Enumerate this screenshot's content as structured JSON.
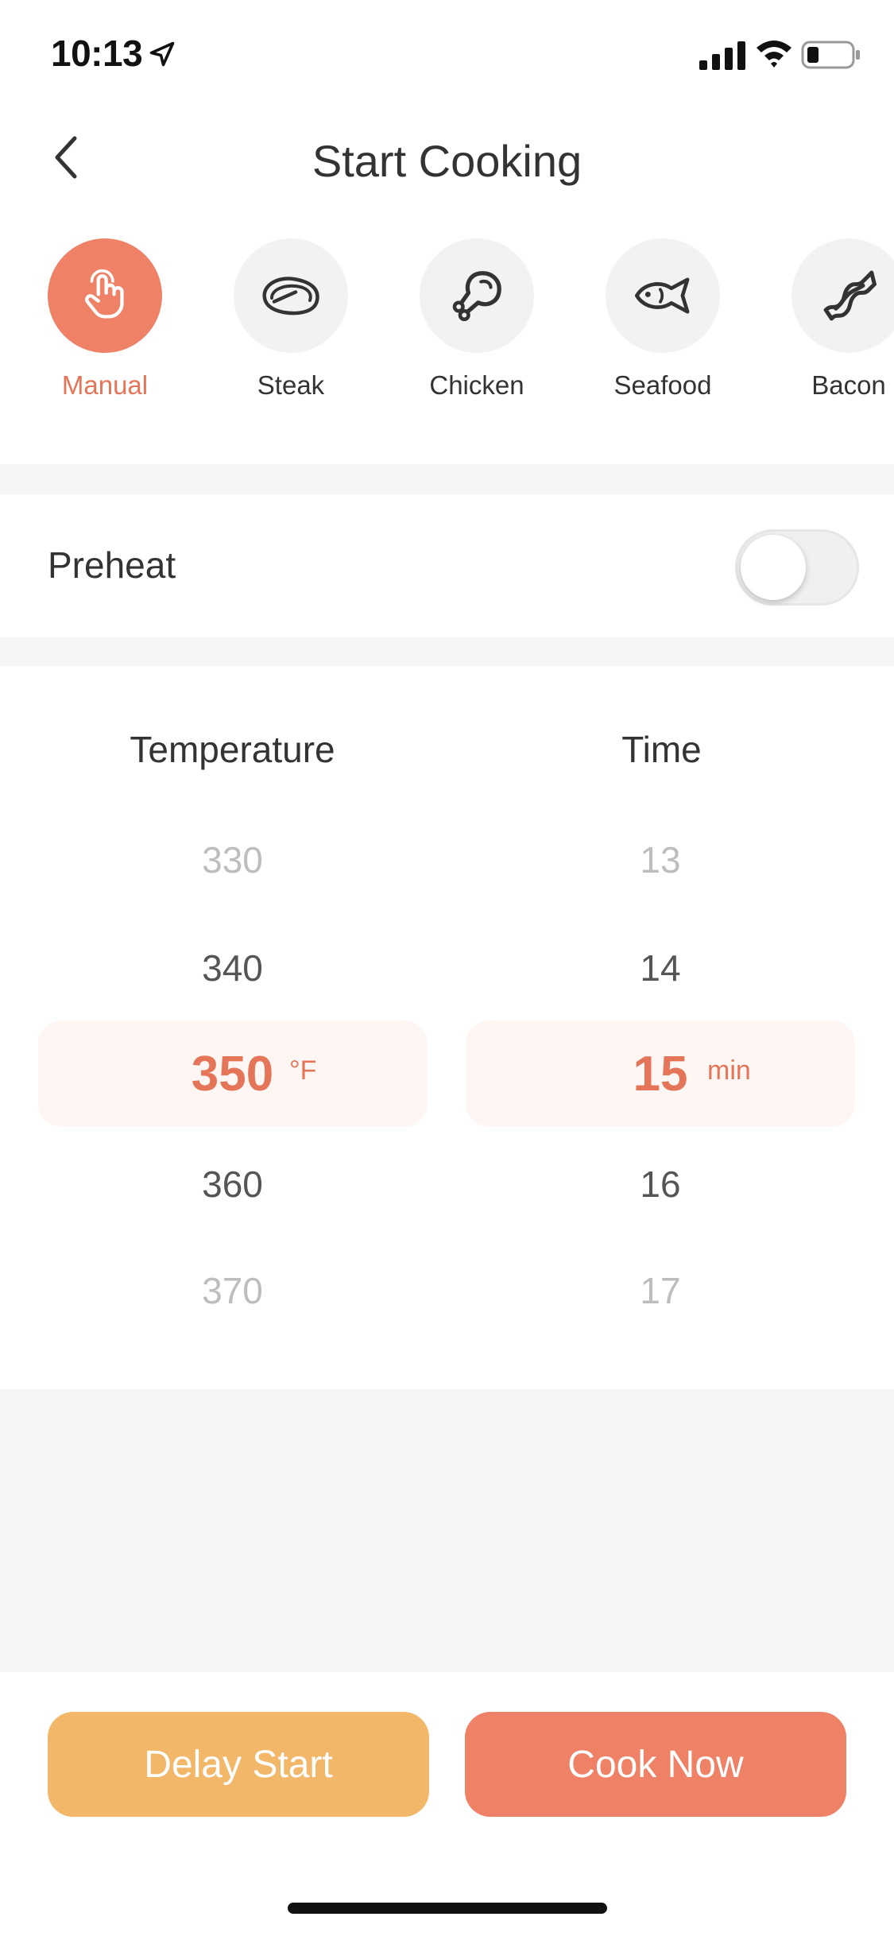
{
  "status_bar": {
    "time": "10:13"
  },
  "header": {
    "title": "Start Cooking"
  },
  "categories": [
    {
      "label": "Manual",
      "icon": "hand-tap-icon",
      "active": true
    },
    {
      "label": "Steak",
      "icon": "steak-icon",
      "active": false
    },
    {
      "label": "Chicken",
      "icon": "chicken-leg-icon",
      "active": false
    },
    {
      "label": "Seafood",
      "icon": "fish-icon",
      "active": false
    },
    {
      "label": "Bacon",
      "icon": "bacon-icon",
      "active": false
    }
  ],
  "preheat": {
    "label": "Preheat",
    "enabled": false
  },
  "temperature": {
    "title": "Temperature",
    "values": [
      "330",
      "340",
      "350",
      "360",
      "370"
    ],
    "selected": "350",
    "unit": "°F"
  },
  "time": {
    "title": "Time",
    "values": [
      "13",
      "14",
      "15",
      "16",
      "17"
    ],
    "selected": "15",
    "unit": "min"
  },
  "actions": {
    "delay_start": "Delay Start",
    "cook_now": "Cook Now"
  },
  "colors": {
    "accent": "#ef8266",
    "accent_text": "#e57558",
    "secondary": "#f3b76a",
    "highlight_bg": "#fdf6f3",
    "band": "#f5f5f5"
  }
}
